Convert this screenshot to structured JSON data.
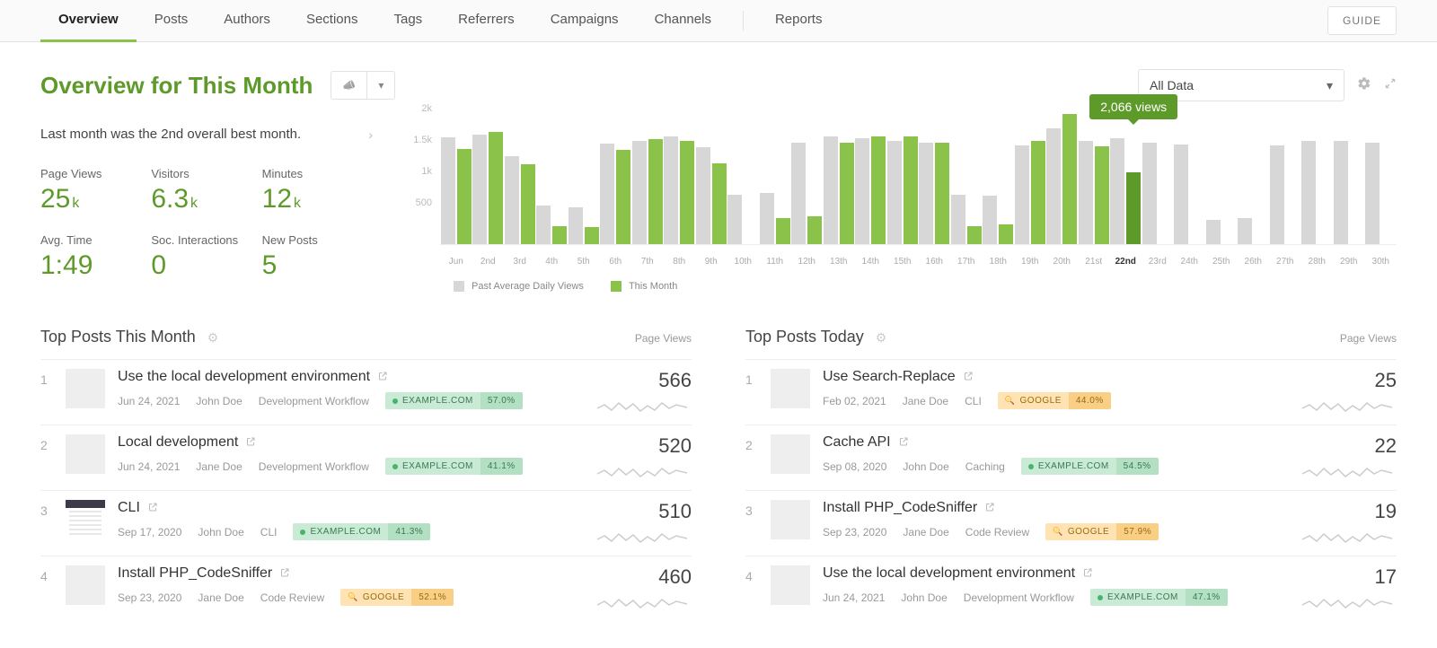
{
  "nav": {
    "tabs": [
      "Overview",
      "Posts",
      "Authors",
      "Sections",
      "Tags",
      "Referrers",
      "Campaigns",
      "Channels"
    ],
    "extra": [
      "Reports"
    ],
    "active": "Overview",
    "guide": "GUIDE"
  },
  "header": {
    "title": "Overview for This Month",
    "data_filter": "All Data"
  },
  "insight": "Last month was the 2nd overall best month.",
  "metrics": {
    "page_views": {
      "label": "Page Views",
      "value": "25",
      "unit": "k"
    },
    "visitors": {
      "label": "Visitors",
      "value": "6.3",
      "unit": "k"
    },
    "minutes": {
      "label": "Minutes",
      "value": "12",
      "unit": "k"
    },
    "avg_time": {
      "label": "Avg. Time",
      "value": "1:49",
      "unit": ""
    },
    "soc": {
      "label": "Soc. Interactions",
      "value": "0",
      "unit": ""
    },
    "new_posts": {
      "label": "New Posts",
      "value": "5",
      "unit": ""
    }
  },
  "chart_data": {
    "type": "bar",
    "title": "",
    "xlabel": "",
    "ylabel": "",
    "ylim": [
      0,
      2000
    ],
    "y_ticks": [
      "500",
      "1k",
      "1.5k",
      "2k"
    ],
    "categories": [
      "Jun",
      "2nd",
      "3rd",
      "4th",
      "5th",
      "6th",
      "7th",
      "8th",
      "9th",
      "10th",
      "11th",
      "12th",
      "13th",
      "14th",
      "15th",
      "16th",
      "17th",
      "18th",
      "19th",
      "20th",
      "21st",
      "22nd",
      "23rd",
      "24th",
      "25th",
      "26th",
      "27th",
      "28th",
      "29th",
      "30th"
    ],
    "highlight_index": 21,
    "highlight_label": "2,066 views",
    "series": [
      {
        "name": "Past Average Daily Views",
        "color": "#d7d7d7",
        "values": [
          1700,
          1750,
          1400,
          610,
          590,
          1600,
          1650,
          1720,
          1550,
          790,
          820,
          1620,
          1720,
          1680,
          1650,
          1610,
          780,
          770,
          1570,
          1850,
          1650,
          1680,
          1620,
          1590,
          390,
          410,
          1570,
          1640,
          1650,
          1620
        ]
      },
      {
        "name": "This Month",
        "color": "#8BC34A",
        "values": [
          1520,
          1780,
          1270,
          280,
          270,
          1500,
          1670,
          1640,
          1290,
          null,
          420,
          440,
          1620,
          1720,
          1720,
          1610,
          290,
          310,
          1650,
          2066,
          1560,
          1150,
          null,
          null,
          null,
          null,
          null,
          null,
          null,
          null
        ]
      }
    ],
    "legend": [
      "Past Average Daily Views",
      "This Month"
    ]
  },
  "top_posts_month": {
    "title": "Top Posts This Month",
    "metric": "Page Views",
    "items": [
      {
        "rank": 1,
        "title": "Use the local development environment",
        "date": "Jun 24, 2021",
        "author": "John Doe",
        "section": "Development Workflow",
        "value": "566",
        "ref": {
          "type": "green",
          "source": "EXAMPLE.COM",
          "pct": "57.0%"
        }
      },
      {
        "rank": 2,
        "title": "Local development",
        "date": "Jun 24, 2021",
        "author": "Jane Doe",
        "section": "Development Workflow",
        "value": "520",
        "ref": {
          "type": "green",
          "source": "EXAMPLE.COM",
          "pct": "41.1%"
        }
      },
      {
        "rank": 3,
        "title": "CLI",
        "date": "Sep 17, 2020",
        "author": "John Doe",
        "section": "CLI",
        "value": "510",
        "ref": {
          "type": "green",
          "source": "EXAMPLE.COM",
          "pct": "41.3%"
        },
        "thumb": "cli"
      },
      {
        "rank": 4,
        "title": "Install PHP_CodeSniffer",
        "date": "Sep 23, 2020",
        "author": "Jane Doe",
        "section": "Code Review",
        "value": "460",
        "ref": {
          "type": "orange",
          "source": "GOOGLE",
          "pct": "52.1%"
        }
      }
    ]
  },
  "top_posts_today": {
    "title": "Top Posts Today",
    "metric": "Page Views",
    "items": [
      {
        "rank": 1,
        "title": "Use Search-Replace",
        "date": "Feb 02, 2021",
        "author": "Jane Doe",
        "section": "CLI",
        "value": "25",
        "ref": {
          "type": "orange",
          "source": "GOOGLE",
          "pct": "44.0%"
        }
      },
      {
        "rank": 2,
        "title": "Cache API",
        "date": "Sep 08, 2020",
        "author": "John Doe",
        "section": "Caching",
        "value": "22",
        "ref": {
          "type": "green",
          "source": "EXAMPLE.COM",
          "pct": "54.5%"
        }
      },
      {
        "rank": 3,
        "title": "Install PHP_CodeSniffer",
        "date": "Sep 23, 2020",
        "author": "Jane Doe",
        "section": "Code Review",
        "value": "19",
        "ref": {
          "type": "orange",
          "source": "GOOGLE",
          "pct": "57.9%"
        }
      },
      {
        "rank": 4,
        "title": "Use the local development environment",
        "date": "Jun 24, 2021",
        "author": "John Doe",
        "section": "Development Workflow",
        "value": "17",
        "ref": {
          "type": "green",
          "source": "EXAMPLE.COM",
          "pct": "47.1%"
        }
      }
    ]
  }
}
